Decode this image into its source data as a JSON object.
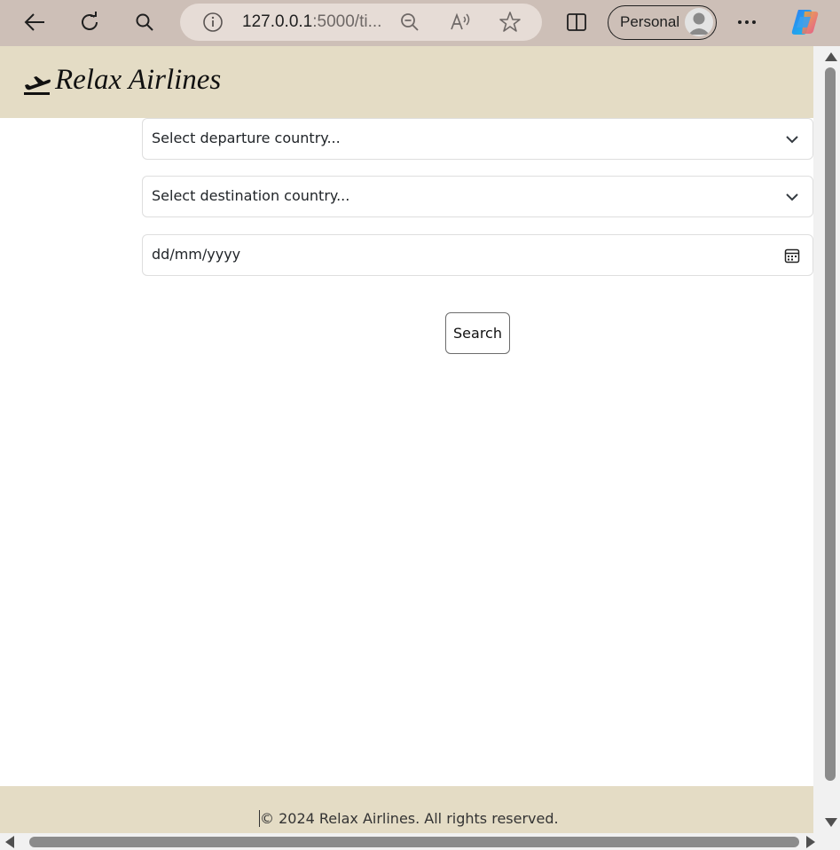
{
  "browser": {
    "url_host": "127.0.0.1",
    "url_rest": ":5000/ti...",
    "profile_label": "Personal",
    "icons": {
      "back": "back-arrow-icon",
      "refresh": "refresh-icon",
      "search": "search-icon",
      "site_info": "info-icon",
      "zoom_out": "zoom-out-icon",
      "read_aloud": "read-aloud-icon",
      "favorite": "star-icon",
      "split_screen": "split-screen-icon",
      "more": "more-dots-icon",
      "copilot": "copilot-icon"
    }
  },
  "header": {
    "brand": "Relax Airlines",
    "icon": "plane-departure-icon"
  },
  "form": {
    "departure_placeholder": "Select departure country...",
    "destination_placeholder": "Select destination country...",
    "date_placeholder": "dd/mm/yyyy",
    "search_label": "Search"
  },
  "footer": {
    "copyright": "© 2024 Relax Airlines. All rights reserved."
  },
  "colors": {
    "toolbar": "#cdbfb7",
    "header_bg": "#e4dcc5",
    "footer_bg": "#e4dcc5"
  }
}
